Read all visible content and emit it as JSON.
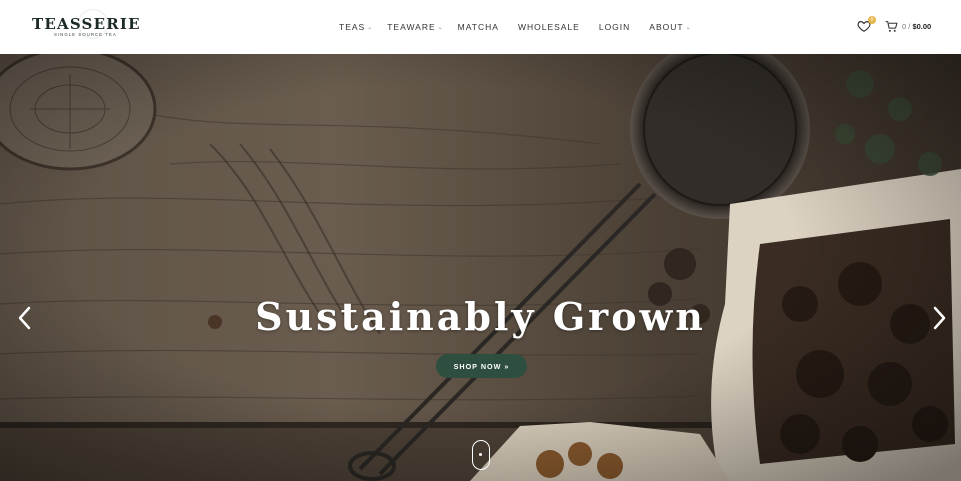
{
  "brand": {
    "name": "TEASSERIE",
    "tagline": "SINGLE SOURCE TEA"
  },
  "nav": {
    "items": [
      {
        "label": "TEAS",
        "has_dropdown": true
      },
      {
        "label": "TEAWARE",
        "has_dropdown": true
      },
      {
        "label": "MATCHA",
        "has_dropdown": false
      },
      {
        "label": "WHOLESALE",
        "has_dropdown": false
      },
      {
        "label": "LOGIN",
        "has_dropdown": false
      },
      {
        "label": "ABOUT",
        "has_dropdown": true
      }
    ],
    "dropdown_icon": "chevron-down-icon"
  },
  "wishlist": {
    "icon": "heart-icon",
    "count": "0"
  },
  "cart": {
    "icon": "cart-icon",
    "count": "0",
    "separator": "/",
    "total": "$0.00"
  },
  "hero": {
    "title": "Sustainably Grown",
    "button_label": "SHOP NOW »",
    "prev_icon": "chevron-left-icon",
    "next_icon": "chevron-right-icon",
    "scroll_icon": "scroll-mouse-icon"
  },
  "colors": {
    "brand_dark": "#1c2b24",
    "button_green": "#2e4e40",
    "badge_gold": "#e6b64c"
  }
}
